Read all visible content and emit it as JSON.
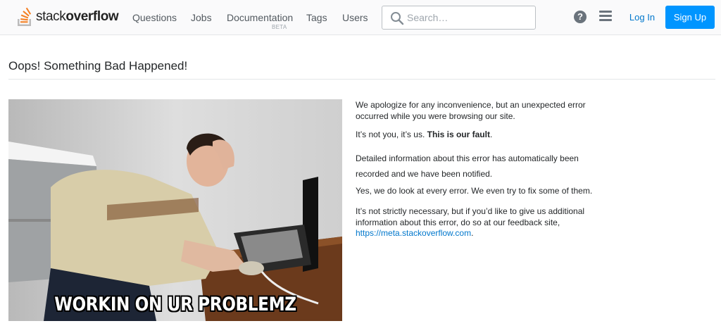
{
  "header": {
    "logo": {
      "word_light": "stack",
      "word_bold": "overflow"
    },
    "nav": [
      {
        "label": "Questions"
      },
      {
        "label": "Jobs"
      },
      {
        "label": "Documentation",
        "badge": "BETA"
      },
      {
        "label": "Tags"
      },
      {
        "label": "Users"
      }
    ],
    "search": {
      "placeholder": "Search…"
    },
    "help_icon": "question-circle",
    "menu_icon": "hamburger",
    "login_label": "Log In",
    "signup_label": "Sign Up"
  },
  "page": {
    "title": "Oops! Something Bad Happened!",
    "image": {
      "caption": "WORKIN ON UR PROBLEMZ"
    },
    "paragraphs": {
      "p1": "We apologize for any inconvenience, but an unexpected error occurred while you were browsing our site.",
      "p2_lead": "It’s not you, it’s us. ",
      "p2_bold": "This is our fault",
      "p2_tail": ".",
      "p3": "Detailed information about this error has automatically been recorded and we have been notified.",
      "p4": "Yes, we do look at every error. We even try to fix some of them.",
      "p5": "It’s not strictly necessary, but if you’d like to give us additional information about this error, do so at our feedback site,",
      "p5_link": "https://meta.stackoverflow.com",
      "p5_tail": "."
    }
  },
  "colors": {
    "accent": "#0095ff",
    "link": "#0077cc",
    "logo_orange": "#f48024",
    "logo_gray": "#bcbbbb"
  }
}
